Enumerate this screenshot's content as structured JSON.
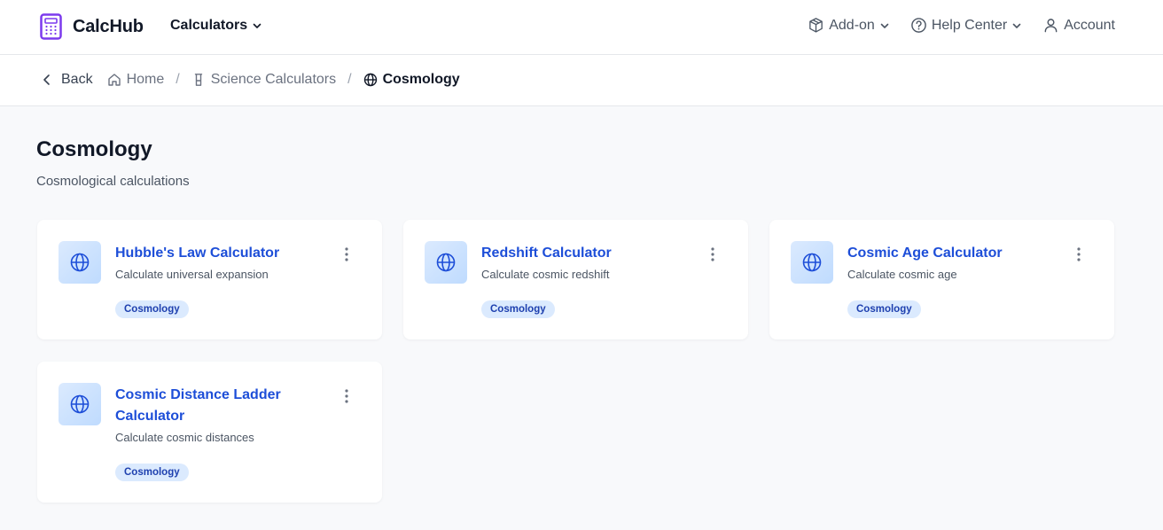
{
  "header": {
    "brand": "CalcHub",
    "calculators_label": "Calculators",
    "addon_label": "Add-on",
    "help_label": "Help Center",
    "account_label": "Account"
  },
  "breadcrumb": {
    "back": "Back",
    "home": "Home",
    "science": "Science Calculators",
    "current": "Cosmology"
  },
  "page": {
    "title": "Cosmology",
    "subtitle": "Cosmological calculations"
  },
  "cards": [
    {
      "title": "Hubble's Law Calculator",
      "description": "Calculate universal expansion",
      "tag": "Cosmology",
      "icon": "globe-icon"
    },
    {
      "title": "Redshift Calculator",
      "description": "Calculate cosmic redshift",
      "tag": "Cosmology",
      "icon": "globe-icon"
    },
    {
      "title": "Cosmic Age Calculator",
      "description": "Calculate cosmic age",
      "tag": "Cosmology",
      "icon": "globe-icon"
    },
    {
      "title": "Cosmic Distance Ladder Calculator",
      "description": "Calculate cosmic distances",
      "tag": "Cosmology",
      "icon": "globe-icon"
    }
  ],
  "colors": {
    "brand": "#7c3aed",
    "link": "#1d4ed8",
    "tag_bg": "#dbeafe",
    "icon": "#1d4ed8"
  }
}
